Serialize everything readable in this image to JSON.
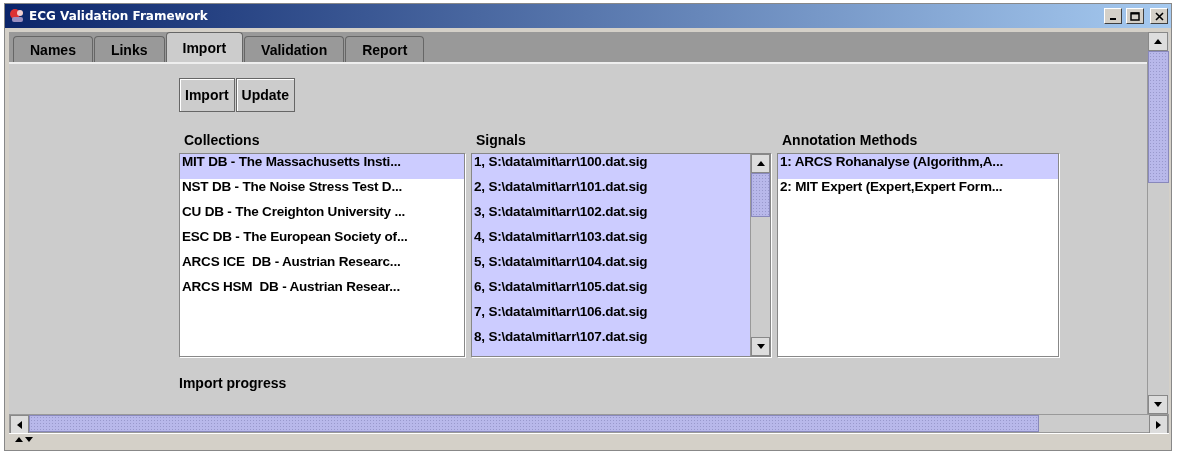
{
  "window": {
    "title": "ECG Validation Framework"
  },
  "tabs": [
    {
      "label": "Names",
      "selected": false
    },
    {
      "label": "Links",
      "selected": false
    },
    {
      "label": "Import",
      "selected": true
    },
    {
      "label": "Validation",
      "selected": false
    },
    {
      "label": "Report",
      "selected": false
    }
  ],
  "buttons": [
    "Import",
    "Update"
  ],
  "lists": [
    {
      "title": "Collections",
      "scrollable": false,
      "items": [
        {
          "label": "MIT DB - The Massachusetts Insti...",
          "selected": true
        },
        {
          "label": "NST DB - The Noise Stress Test D...",
          "selected": false
        },
        {
          "label": "CU DB - The Creighton University ...",
          "selected": false
        },
        {
          "label": "ESC DB - The European Society of...",
          "selected": false
        },
        {
          "label": "ARCS ICE  DB - Austrian Researc...",
          "selected": false
        },
        {
          "label": "ARCS HSM  DB - Austrian Resear...",
          "selected": false
        }
      ]
    },
    {
      "title": "Signals",
      "scrollable": true,
      "items": [
        {
          "label": "1, S:\\data\\mit\\arr\\100.dat.sig",
          "selected": true
        },
        {
          "label": "2, S:\\data\\mit\\arr\\101.dat.sig",
          "selected": true
        },
        {
          "label": "3, S:\\data\\mit\\arr\\102.dat.sig",
          "selected": true
        },
        {
          "label": "4, S:\\data\\mit\\arr\\103.dat.sig",
          "selected": true
        },
        {
          "label": "5, S:\\data\\mit\\arr\\104.dat.sig",
          "selected": true
        },
        {
          "label": "6, S:\\data\\mit\\arr\\105.dat.sig",
          "selected": true
        },
        {
          "label": "7, S:\\data\\mit\\arr\\106.dat.sig",
          "selected": true
        },
        {
          "label": "8, S:\\data\\mit\\arr\\107.dat.sig",
          "selected": true
        }
      ]
    },
    {
      "title": "Annotation Methods",
      "scrollable": false,
      "items": [
        {
          "label": "1: ARCS Rohanalyse (Algorithm,A...",
          "selected": true
        },
        {
          "label": "2: MIT Expert (Expert,Expert Form...",
          "selected": false
        }
      ]
    }
  ],
  "progress_label": "Import progress"
}
